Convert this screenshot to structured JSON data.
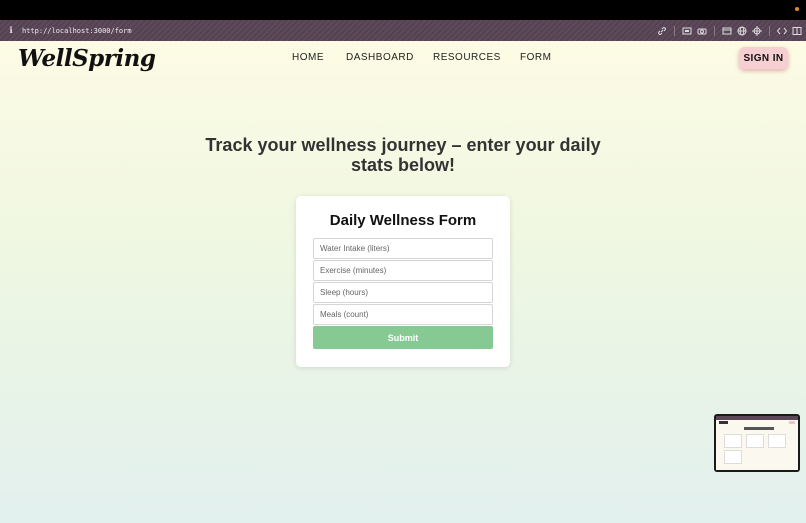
{
  "browser": {
    "url": "http://localhost:3000/form",
    "info_icon": "info-icon",
    "tool_icons": [
      "link-icon",
      "screenshot-icon",
      "camera-icon",
      "sidebar-icon",
      "globe-icon",
      "crosshair-icon",
      "code-icon",
      "split-view-icon"
    ]
  },
  "header": {
    "logo": "WellSpring",
    "nav": [
      "HOME",
      "DASHBOARD",
      "RESOURCES",
      "FORM"
    ],
    "sign_in": "SIGN IN"
  },
  "main": {
    "headline": "Track your wellness journey – enter your daily stats below!",
    "form": {
      "title": "Daily Wellness Form",
      "fields": [
        {
          "placeholder": "Water Intake (liters)",
          "value": ""
        },
        {
          "placeholder": "Exercise (minutes)",
          "value": ""
        },
        {
          "placeholder": "Sleep (hours)",
          "value": ""
        },
        {
          "placeholder": "Meals (count)",
          "value": ""
        }
      ],
      "submit": "Submit"
    }
  },
  "colors": {
    "accent_submit": "#86c993",
    "sign_in_bg": "#f6cfd3",
    "browser_bar": "#5d4a5c"
  }
}
